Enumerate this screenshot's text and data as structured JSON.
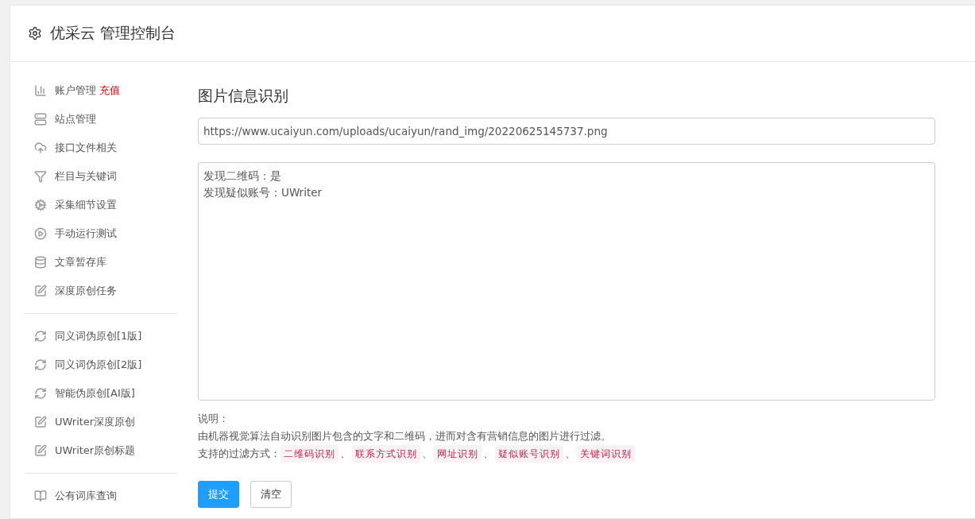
{
  "header": {
    "title": "优采云 管理控制台"
  },
  "sidebar": {
    "groups": [
      {
        "items": [
          {
            "label": "账户管理",
            "badge": "充值"
          },
          {
            "label": "站点管理"
          },
          {
            "label": "接口文件相关"
          },
          {
            "label": "栏目与关键词"
          },
          {
            "label": "采集细节设置"
          },
          {
            "label": "手动运行测试"
          },
          {
            "label": "文章暂存库"
          },
          {
            "label": "深度原创任务"
          }
        ]
      },
      {
        "items": [
          {
            "label": "同义词伪原创[1版]"
          },
          {
            "label": "同义词伪原创[2版]"
          },
          {
            "label": "智能伪原创[AI版]"
          },
          {
            "label": "UWriter深度原创"
          },
          {
            "label": "UWriter原创标题"
          }
        ]
      },
      {
        "items": [
          {
            "label": "公有词库查询"
          }
        ]
      }
    ]
  },
  "main": {
    "title": "图片信息识别",
    "url_field": {
      "value": "https://www.ucaiyun.com/uploads/ucaiyun/rand_img/20220625145737.png"
    },
    "result_field": {
      "lines": [
        "发现二维码：是",
        "发现疑似账号：UWriter"
      ]
    },
    "notes": {
      "heading": "说明：",
      "description": "由机器视觉算法自动识别图片包含的文字和二维码，进而对含有营销信息的图片进行过滤。",
      "filters_label": "支持的过滤方式：",
      "filters": [
        {
          "label": "二维码识别",
          "after": "、"
        },
        {
          "label": "联系方式识别",
          "after": "、"
        },
        {
          "label": "网址识别",
          "after": "、"
        },
        {
          "label": "疑似账号识别",
          "after": "、"
        },
        {
          "label": "关键词识别"
        }
      ]
    },
    "buttons": [
      {
        "label": "提交",
        "kind": "primary"
      },
      {
        "label": "清空",
        "kind": "default"
      }
    ]
  }
}
